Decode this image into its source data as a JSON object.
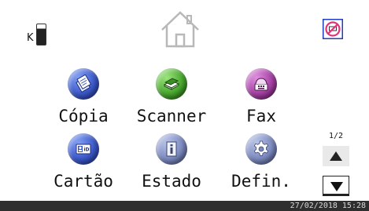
{
  "toner": {
    "label": "K",
    "level": 0.78
  },
  "apps": [
    {
      "label": "Cópia",
      "icon": "copy-icon",
      "color": "#3b57c9"
    },
    {
      "label": "Scanner",
      "icon": "scanner-icon",
      "color": "#46a62c"
    },
    {
      "label": "Fax",
      "icon": "fax-icon",
      "color": "#a43fa3"
    },
    {
      "label": "Cartão",
      "icon": "id-card-icon",
      "color": "#3b57c9"
    },
    {
      "label": "Estado",
      "icon": "info-document-icon",
      "color": "#7b89bf"
    },
    {
      "label": "Defin.",
      "icon": "gear-icon",
      "color": "#7b89bf"
    }
  ],
  "pager": {
    "count": "1/2"
  },
  "status": {
    "datetime": "27/02/2018 15:28"
  },
  "icons": {
    "home": "home-icon",
    "nosign": "no-entry-icon"
  },
  "colors": {
    "nosign": "#e0347a",
    "statusbar": "#2e2e2e"
  }
}
